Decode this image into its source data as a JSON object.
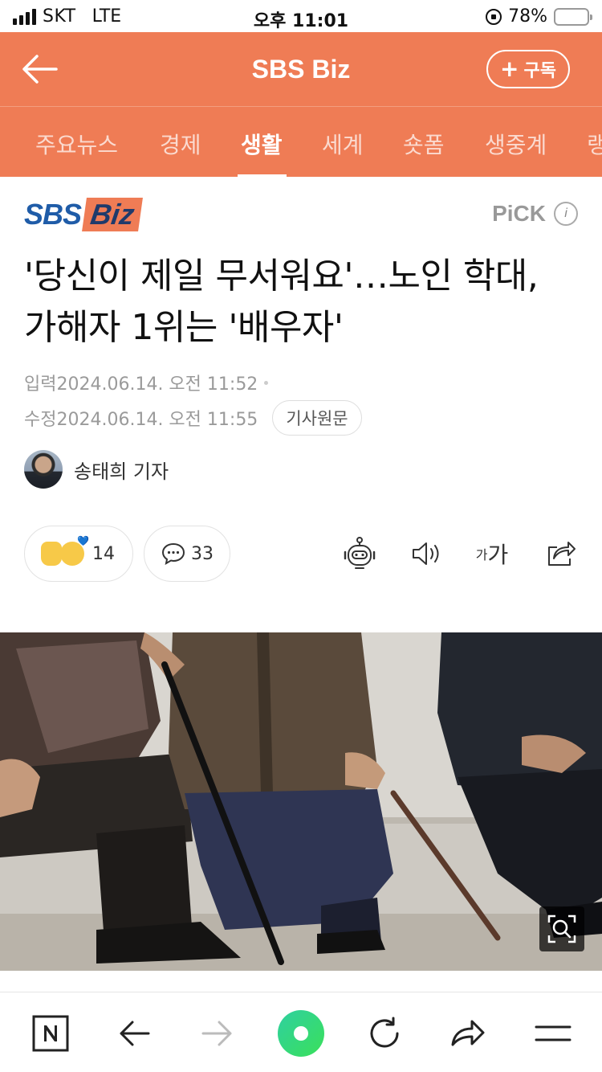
{
  "status_bar": {
    "carrier": "SKT",
    "network": "LTE",
    "time": "오후 11:01",
    "battery_percent": "78%",
    "battery_level": 0.78,
    "battery_color": "#f5c518"
  },
  "header": {
    "title": "SBS Biz",
    "subscribe_plus": "+",
    "subscribe_label": "구독",
    "background_color": "#ef7c55"
  },
  "tabs": [
    {
      "label": "주요뉴스",
      "active": false
    },
    {
      "label": "경제",
      "active": false
    },
    {
      "label": "생활",
      "active": true
    },
    {
      "label": "세계",
      "active": false
    },
    {
      "label": "숏폼",
      "active": false
    },
    {
      "label": "생중계",
      "active": false
    },
    {
      "label": "랭",
      "active": false
    }
  ],
  "article": {
    "brand_sbs": "SBS",
    "brand_biz": "Biz",
    "pick_label": "PiCK",
    "pick_info": "i",
    "headline": "'당신이 제일 무서워요'…노인 학대, 가해자 1위는 '배우자'",
    "input_label": "입력",
    "input_time": "2024.06.14. 오전 11:52",
    "modified_label": "수정",
    "modified_time": "2024.06.14. 오전 11:55",
    "original_button": "기사원문",
    "reporter": "송태희 기자"
  },
  "reactions": {
    "like_count": "14",
    "comment_count": "33",
    "font_small": "가",
    "font_large": "가"
  },
  "icons": {
    "back": "arrow-left-icon",
    "robot": "robot-icon",
    "speaker": "speaker-icon",
    "share": "share-icon",
    "zoom": "zoom-icon",
    "naver": "naver-n-icon",
    "nav_back": "arrow-left-icon",
    "nav_forward": "arrow-right-icon",
    "green_dot": "green-dot-icon",
    "refresh": "refresh-icon",
    "nav_share": "share-arrow-icon",
    "menu": "menu-icon"
  }
}
